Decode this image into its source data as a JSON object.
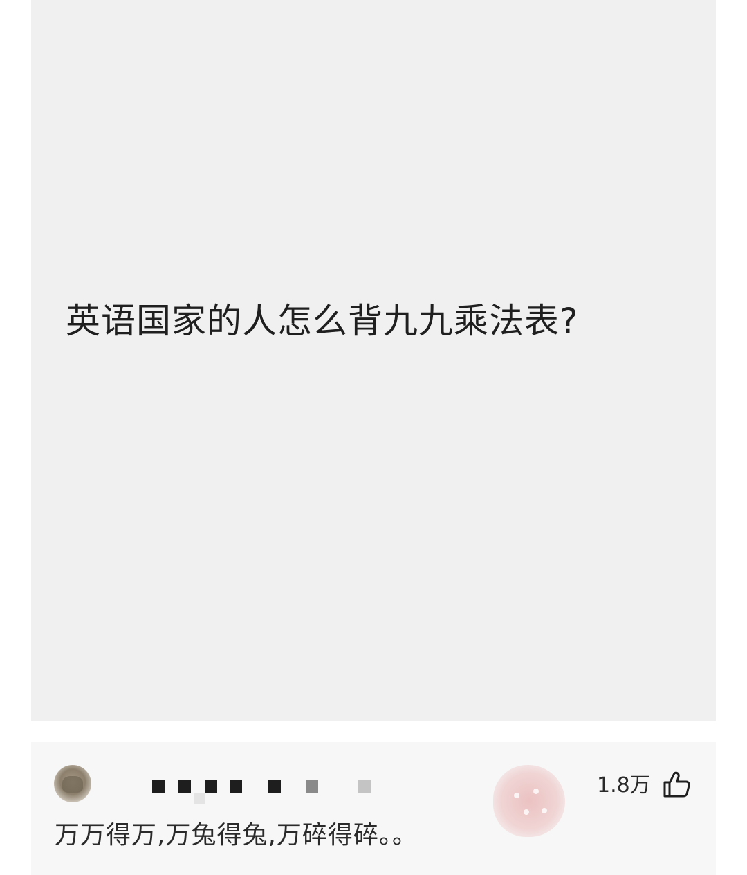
{
  "post": {
    "question": "英语国家的人怎么背九九乘法表?"
  },
  "comment": {
    "avatar_icon": "user-avatar",
    "username": "",
    "like_count": "1.8万",
    "like_icon": "thumbs-up-icon",
    "text": "万万得万,万兔得兔,万碎得碎。。",
    "stamp_color": "#e29696"
  }
}
